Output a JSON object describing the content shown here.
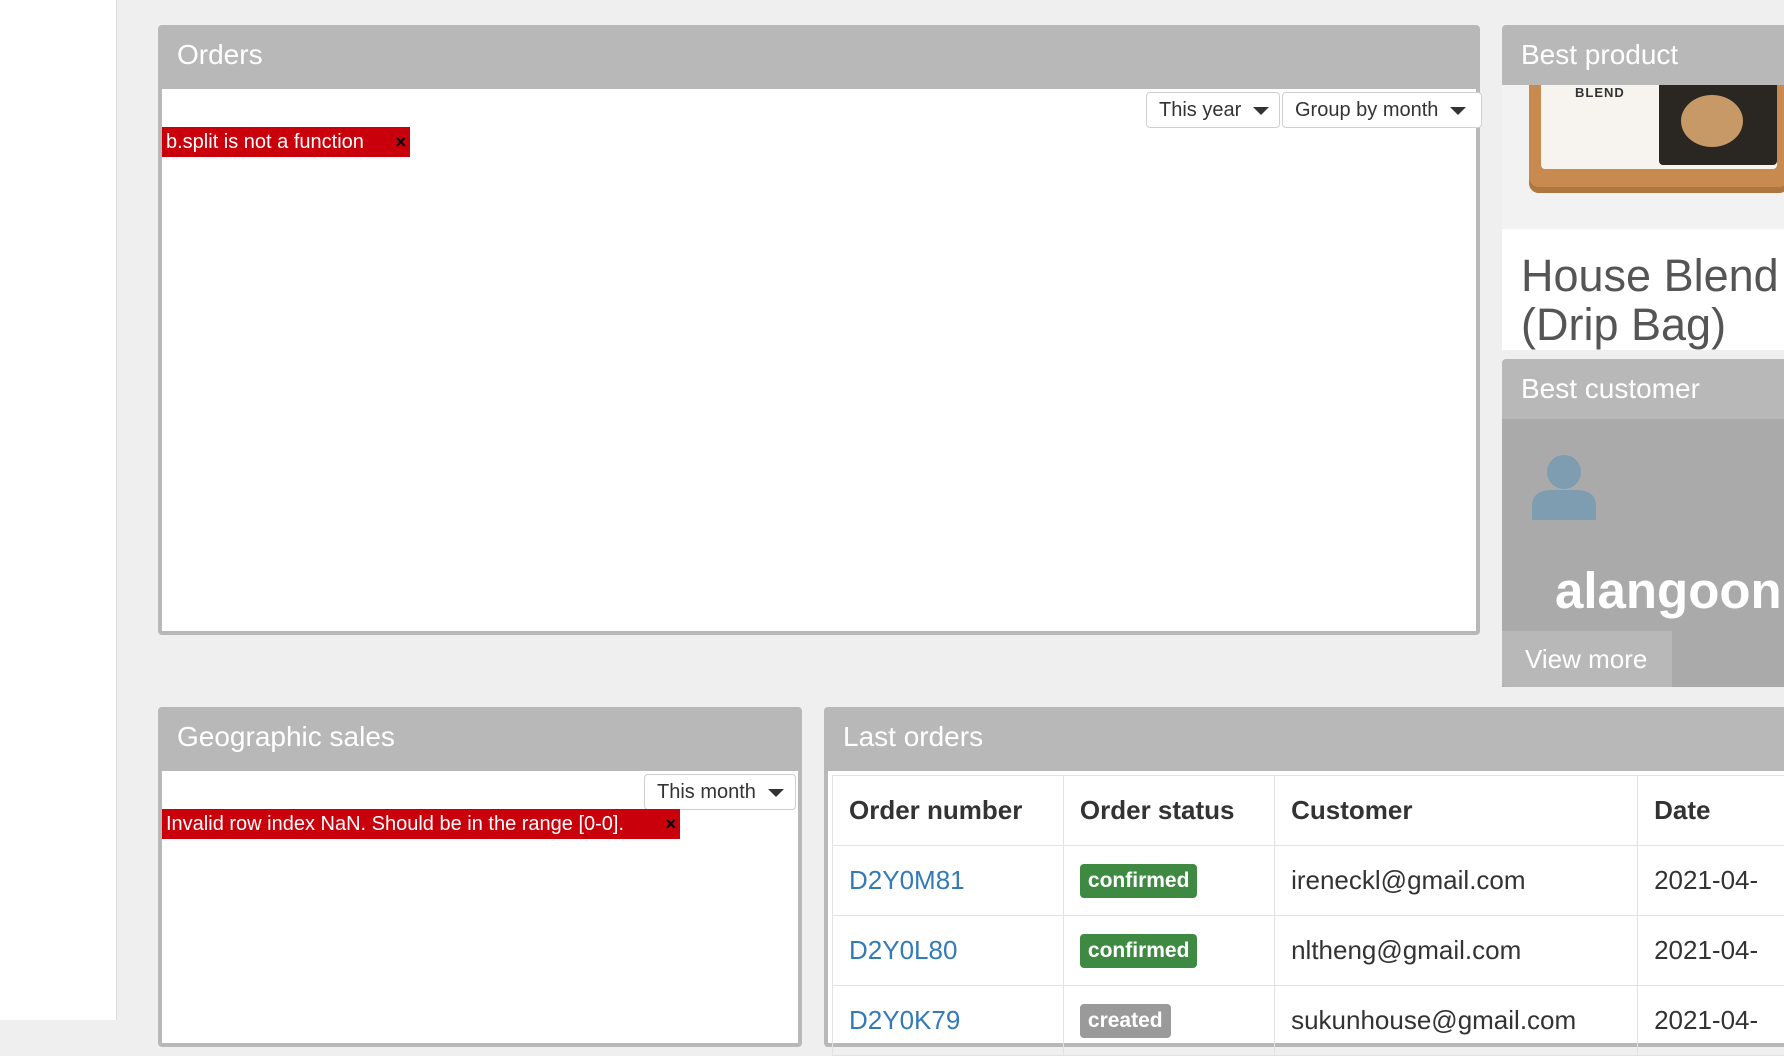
{
  "orders_panel": {
    "title": "Orders",
    "period_dropdown": "This year",
    "group_dropdown": "Group by month",
    "error": "b.split is not a function",
    "error_close": "×"
  },
  "best_product": {
    "title": "Best product",
    "image_text": "BLEND",
    "name": "House Blend (Drip Bag)"
  },
  "best_customer": {
    "title": "Best customer",
    "avatar_icon": "user-icon",
    "name": "alangoon",
    "view_more": "View more"
  },
  "geo_panel": {
    "title": "Geographic sales",
    "period_dropdown": "This month",
    "error": "Invalid row index NaN. Should be in the range [0-0].",
    "error_close": "×"
  },
  "last_orders": {
    "title": "Last orders",
    "columns": [
      "Order number",
      "Order status",
      "Customer",
      "Date"
    ],
    "rows": [
      {
        "number": "D2Y0M81",
        "status": "confirmed",
        "customer": "ireneckl@gmail.com",
        "date": "2021-04-"
      },
      {
        "number": "D2Y0L80",
        "status": "confirmed",
        "customer": "nltheng@gmail.com",
        "date": "2021-04-"
      },
      {
        "number": "D2Y0K79",
        "status": "created",
        "customer": "sukunhouse@gmail.com",
        "date": "2021-04-"
      }
    ]
  },
  "colors": {
    "panel_header": "#b8b8b8",
    "error_bg": "#c9000b",
    "link": "#337ab7",
    "confirmed": "#3f8a43",
    "created": "#9a9a9a"
  }
}
